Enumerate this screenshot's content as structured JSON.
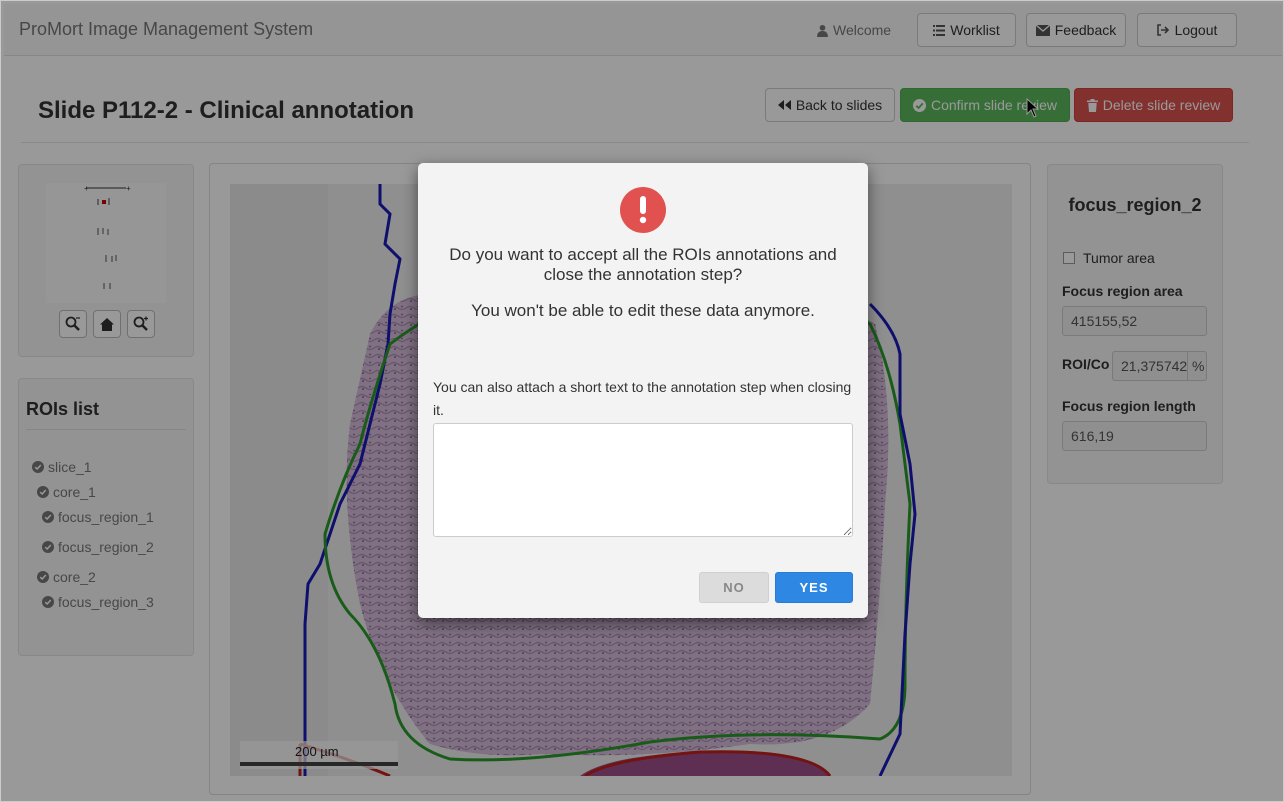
{
  "navbar": {
    "brand": "ProMort Image Management System",
    "welcome": "Welcome",
    "worklist": "Worklist",
    "feedback": "Feedback",
    "logout": "Logout"
  },
  "header": {
    "title": "Slide P112-2 - Clinical annotation",
    "back_label": "Back to slides",
    "confirm_label": "Confirm slide review",
    "delete_label": "Delete slide review"
  },
  "rois": {
    "title": "ROIs list",
    "items": [
      "slice_1",
      "core_1",
      "focus_region_1",
      "focus_region_2",
      "core_2",
      "focus_region_3"
    ]
  },
  "viewer": {
    "scale_label": "200 µm"
  },
  "details": {
    "title": "focus_region_2",
    "tumor_label": "Tumor area",
    "area_label": "Focus region area",
    "area_value": "415155,52",
    "ratio_label": "ROI/Co",
    "ratio_value": "21,375742",
    "ratio_unit": "%",
    "length_label": "Focus region length",
    "length_value": "616,19"
  },
  "modal": {
    "question": "Do you want to accept all the ROIs annotations and close the annotation step?",
    "warning": "You won't be able to edit these data anymore.",
    "attach_text": "You can also attach a short text to the annotation step when closing it.",
    "notes_value": "",
    "no_label": "NO",
    "yes_label": "YES"
  },
  "colors": {
    "success": "#5cb85c",
    "danger": "#d9534f",
    "primary": "#2f87e4",
    "warning_icon": "#e0514f"
  }
}
